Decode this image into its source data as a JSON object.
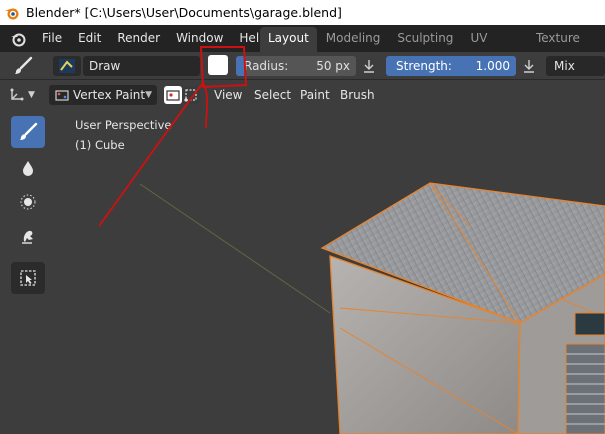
{
  "titlebar": {
    "title": "Blender* [C:\\Users\\User\\Documents\\garage.blend]"
  },
  "menubar": {
    "items": [
      "File",
      "Edit",
      "Render",
      "Window",
      "Help"
    ],
    "workspaces": [
      {
        "label": "Layout",
        "active": true
      },
      {
        "label": "Modeling",
        "active": false
      },
      {
        "label": "Sculpting",
        "active": false
      },
      {
        "label": "UV Editing",
        "active": false
      },
      {
        "label": "Texture Paint",
        "active": false
      }
    ]
  },
  "toolheader": {
    "brush_name": "Draw",
    "color": "#ffffff",
    "radius_label": "Radius:",
    "radius_value": "50 px",
    "strength_label": "Strength:",
    "strength_value": "1.000",
    "blend_mode": "Mix"
  },
  "viewport_header": {
    "mode": "Vertex Paint",
    "menus": [
      "View",
      "Select",
      "Paint",
      "Brush"
    ]
  },
  "viewport": {
    "perspective": "User Perspective",
    "object": "(1) Cube"
  },
  "toolbar": {
    "tools": [
      "brush-draw-icon",
      "blur-drop-icon",
      "average-icon",
      "smear-icon",
      "select-box-icon"
    ],
    "active_tool": "brush-draw-icon"
  },
  "colors": {
    "accent": "#4772b3",
    "selection_outline": "#e8832a",
    "annotation": "#cc1111"
  }
}
